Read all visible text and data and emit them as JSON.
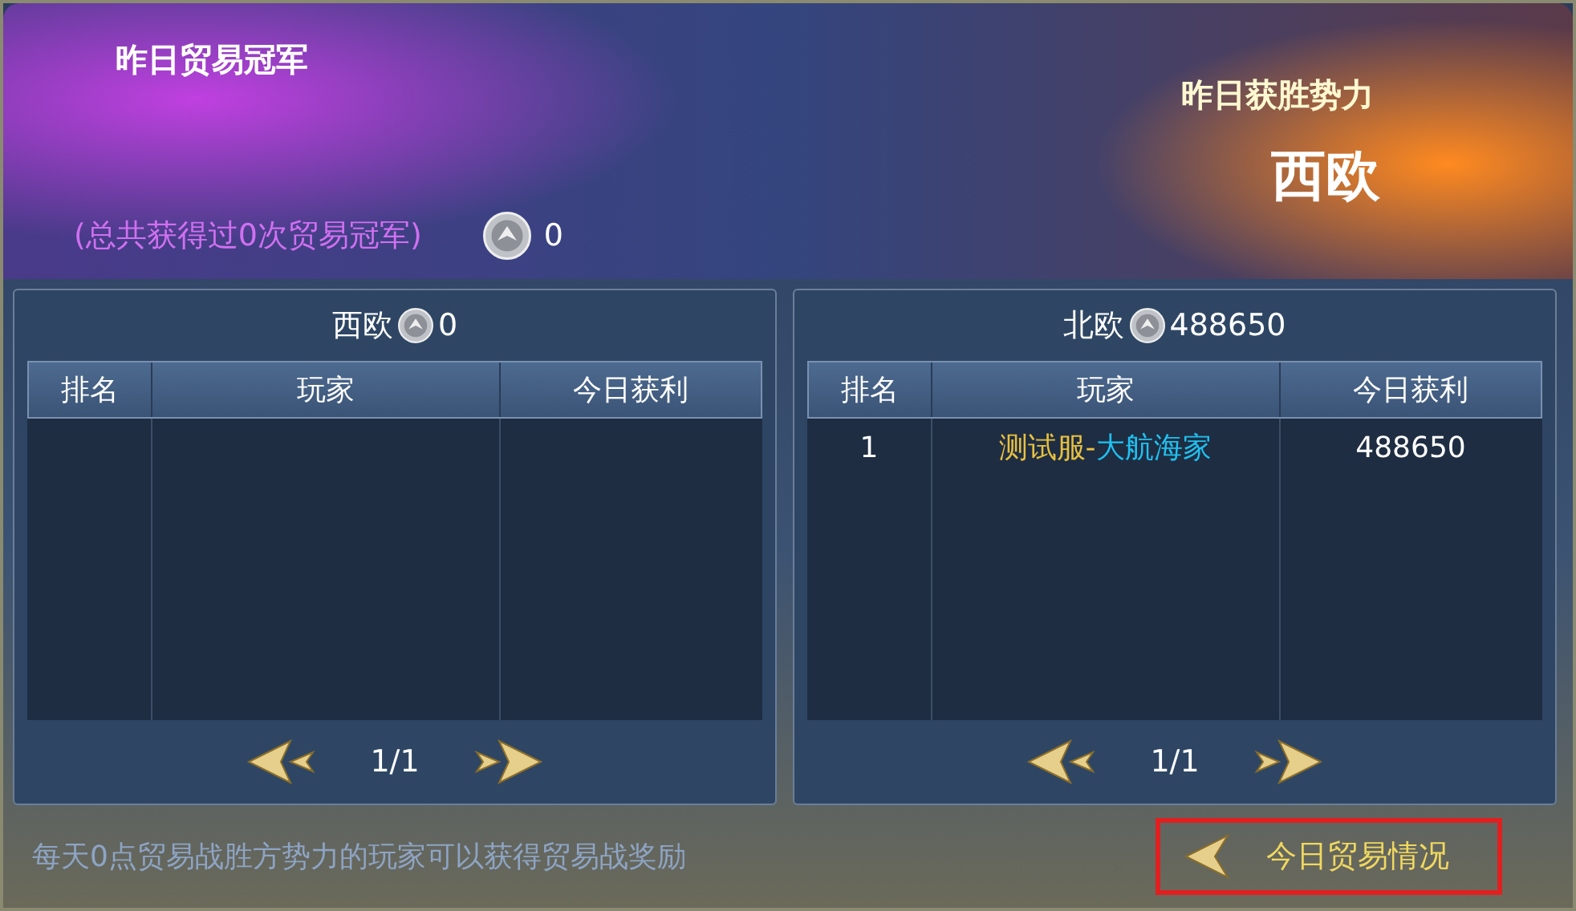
{
  "banner": {
    "champion_title": "昨日贸易冠军",
    "champion_count": "(总共获得过0次贸易冠军)",
    "coins": "0",
    "winner_label": "昨日获胜势力",
    "winner": "西欧"
  },
  "panels": [
    {
      "faction": "西欧",
      "coins": "0",
      "columns": [
        "排名",
        "玩家",
        "今日获利"
      ],
      "page": "1/1"
    },
    {
      "faction": "北欧",
      "coins": "488650",
      "columns": [
        "排名",
        "玩家",
        "今日获利"
      ],
      "rows": [
        {
          "rank": "1",
          "server": "测试服-",
          "player": "大航海家",
          "profit": "488650"
        }
      ],
      "page": "1/1"
    }
  ],
  "footer": {
    "note": "每天0点贸易战胜方势力的玩家可以获得贸易战奖励",
    "button": "今日贸易情况"
  }
}
